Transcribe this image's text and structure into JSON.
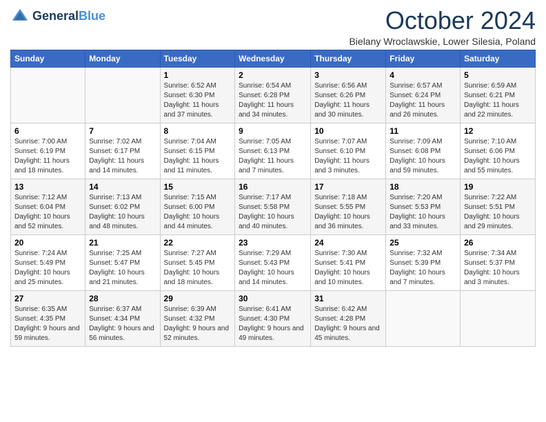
{
  "logo": {
    "line1": "General",
    "line2": "Blue"
  },
  "title": "October 2024",
  "location": "Bielany Wroclawskie, Lower Silesia, Poland",
  "days_of_week": [
    "Sunday",
    "Monday",
    "Tuesday",
    "Wednesday",
    "Thursday",
    "Friday",
    "Saturday"
  ],
  "weeks": [
    [
      {
        "day": "",
        "info": ""
      },
      {
        "day": "",
        "info": ""
      },
      {
        "day": "1",
        "info": "Sunrise: 6:52 AM\nSunset: 6:30 PM\nDaylight: 11 hours and 37 minutes."
      },
      {
        "day": "2",
        "info": "Sunrise: 6:54 AM\nSunset: 6:28 PM\nDaylight: 11 hours and 34 minutes."
      },
      {
        "day": "3",
        "info": "Sunrise: 6:56 AM\nSunset: 6:26 PM\nDaylight: 11 hours and 30 minutes."
      },
      {
        "day": "4",
        "info": "Sunrise: 6:57 AM\nSunset: 6:24 PM\nDaylight: 11 hours and 26 minutes."
      },
      {
        "day": "5",
        "info": "Sunrise: 6:59 AM\nSunset: 6:21 PM\nDaylight: 11 hours and 22 minutes."
      }
    ],
    [
      {
        "day": "6",
        "info": "Sunrise: 7:00 AM\nSunset: 6:19 PM\nDaylight: 11 hours and 18 minutes."
      },
      {
        "day": "7",
        "info": "Sunrise: 7:02 AM\nSunset: 6:17 PM\nDaylight: 11 hours and 14 minutes."
      },
      {
        "day": "8",
        "info": "Sunrise: 7:04 AM\nSunset: 6:15 PM\nDaylight: 11 hours and 11 minutes."
      },
      {
        "day": "9",
        "info": "Sunrise: 7:05 AM\nSunset: 6:13 PM\nDaylight: 11 hours and 7 minutes."
      },
      {
        "day": "10",
        "info": "Sunrise: 7:07 AM\nSunset: 6:10 PM\nDaylight: 11 hours and 3 minutes."
      },
      {
        "day": "11",
        "info": "Sunrise: 7:09 AM\nSunset: 6:08 PM\nDaylight: 10 hours and 59 minutes."
      },
      {
        "day": "12",
        "info": "Sunrise: 7:10 AM\nSunset: 6:06 PM\nDaylight: 10 hours and 55 minutes."
      }
    ],
    [
      {
        "day": "13",
        "info": "Sunrise: 7:12 AM\nSunset: 6:04 PM\nDaylight: 10 hours and 52 minutes."
      },
      {
        "day": "14",
        "info": "Sunrise: 7:13 AM\nSunset: 6:02 PM\nDaylight: 10 hours and 48 minutes."
      },
      {
        "day": "15",
        "info": "Sunrise: 7:15 AM\nSunset: 6:00 PM\nDaylight: 10 hours and 44 minutes."
      },
      {
        "day": "16",
        "info": "Sunrise: 7:17 AM\nSunset: 5:58 PM\nDaylight: 10 hours and 40 minutes."
      },
      {
        "day": "17",
        "info": "Sunrise: 7:18 AM\nSunset: 5:55 PM\nDaylight: 10 hours and 36 minutes."
      },
      {
        "day": "18",
        "info": "Sunrise: 7:20 AM\nSunset: 5:53 PM\nDaylight: 10 hours and 33 minutes."
      },
      {
        "day": "19",
        "info": "Sunrise: 7:22 AM\nSunset: 5:51 PM\nDaylight: 10 hours and 29 minutes."
      }
    ],
    [
      {
        "day": "20",
        "info": "Sunrise: 7:24 AM\nSunset: 5:49 PM\nDaylight: 10 hours and 25 minutes."
      },
      {
        "day": "21",
        "info": "Sunrise: 7:25 AM\nSunset: 5:47 PM\nDaylight: 10 hours and 21 minutes."
      },
      {
        "day": "22",
        "info": "Sunrise: 7:27 AM\nSunset: 5:45 PM\nDaylight: 10 hours and 18 minutes."
      },
      {
        "day": "23",
        "info": "Sunrise: 7:29 AM\nSunset: 5:43 PM\nDaylight: 10 hours and 14 minutes."
      },
      {
        "day": "24",
        "info": "Sunrise: 7:30 AM\nSunset: 5:41 PM\nDaylight: 10 hours and 10 minutes."
      },
      {
        "day": "25",
        "info": "Sunrise: 7:32 AM\nSunset: 5:39 PM\nDaylight: 10 hours and 7 minutes."
      },
      {
        "day": "26",
        "info": "Sunrise: 7:34 AM\nSunset: 5:37 PM\nDaylight: 10 hours and 3 minutes."
      }
    ],
    [
      {
        "day": "27",
        "info": "Sunrise: 6:35 AM\nSunset: 4:35 PM\nDaylight: 9 hours and 59 minutes."
      },
      {
        "day": "28",
        "info": "Sunrise: 6:37 AM\nSunset: 4:34 PM\nDaylight: 9 hours and 56 minutes."
      },
      {
        "day": "29",
        "info": "Sunrise: 6:39 AM\nSunset: 4:32 PM\nDaylight: 9 hours and 52 minutes."
      },
      {
        "day": "30",
        "info": "Sunrise: 6:41 AM\nSunset: 4:30 PM\nDaylight: 9 hours and 49 minutes."
      },
      {
        "day": "31",
        "info": "Sunrise: 6:42 AM\nSunset: 4:28 PM\nDaylight: 9 hours and 45 minutes."
      },
      {
        "day": "",
        "info": ""
      },
      {
        "day": "",
        "info": ""
      }
    ]
  ]
}
